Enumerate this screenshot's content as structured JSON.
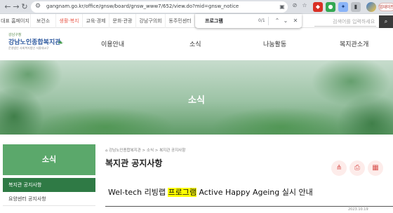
{
  "browser": {
    "url": "gangnam.go.kr/office/gnsw/board/gnsw_www7/652/view.do?mid=gnsw_notice",
    "update_label": "업데이트"
  },
  "find": {
    "query": "프로그램",
    "count": "0/1"
  },
  "gov_tabs": [
    {
      "label": "대표 홈페이지"
    },
    {
      "label": "보건소"
    },
    {
      "label": "생활·복지",
      "active": true
    },
    {
      "label": "교육·경제"
    },
    {
      "label": "문화·관광"
    },
    {
      "label": "강남구의회"
    },
    {
      "label": "동주민센터"
    }
  ],
  "site_search": {
    "placeholder": "검색어를 입력하세요"
  },
  "logo": {
    "small": "강남구청",
    "name": "강남노인종합복지관",
    "sub": "운영법인 사회복지법인 서울대교구"
  },
  "gnb": [
    "이용안내",
    "소식",
    "나눔활동",
    "복지관소개"
  ],
  "banner": {
    "title": "소식"
  },
  "lnb": {
    "title": "소식",
    "items": [
      "복지관 공지사항",
      "요양센터 공지사항"
    ]
  },
  "content": {
    "breadcrumb": "강남노인종합복지관 > 소식 > 복지관 공지사항",
    "title": "복지관 공지사항",
    "post": {
      "title_before": "Wel-tech 리빙랩 ",
      "title_highlight": "프로그램",
      "title_after": " Active Happy Ageing 실시 안내",
      "date": "2023.10.19"
    }
  },
  "colors": {
    "lnb_head": "#5ba86b",
    "lnb_active": "#2f7a45",
    "highlight": "#ffff00",
    "active_tab": "#e8594a"
  }
}
